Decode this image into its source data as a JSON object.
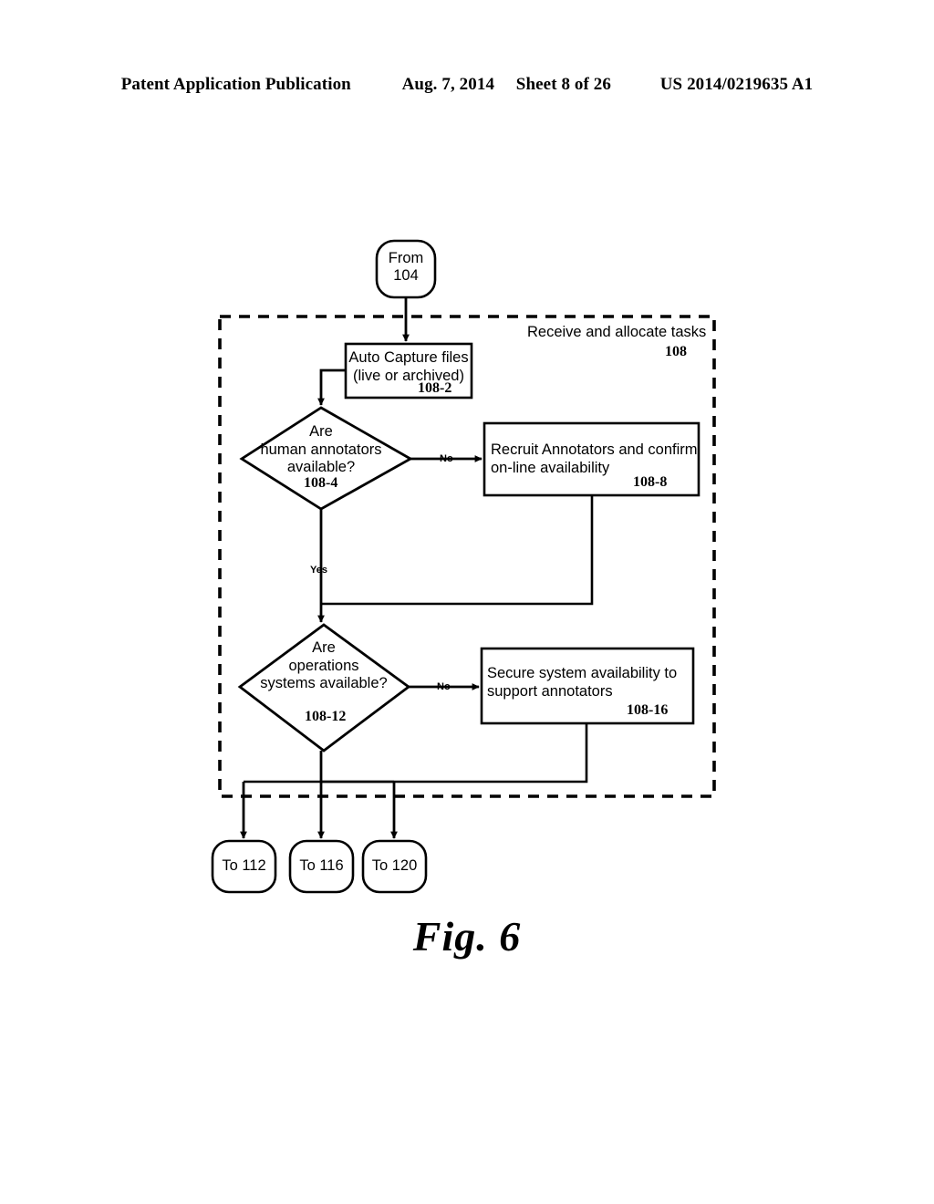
{
  "header": {
    "publication": "Patent Application Publication",
    "date": "Aug. 7, 2014",
    "sheet": "Sheet 8 of 26",
    "patent_number": "US 2014/0219635 A1"
  },
  "figure": {
    "caption": "Fig. 6",
    "group": {
      "label": "Receive and allocate tasks",
      "ref": "108"
    },
    "nodes": {
      "from_104": {
        "text": "From\n104"
      },
      "auto_capture": {
        "text": "Auto Capture files\n(live or archived)",
        "ref": "108-2"
      },
      "decision_annotators": {
        "text": "Are\nhuman annotators\navailable?",
        "ref": "108-4"
      },
      "recruit_annotators": {
        "text": "Recruit Annotators and confirm\non-line availability",
        "ref": "108-8"
      },
      "decision_ops_systems": {
        "text": "Are\noperations\nsystems available?",
        "ref": "108-12"
      },
      "secure_system": {
        "text": "Secure system availability to\nsupport annotators",
        "ref": "108-16"
      },
      "to_112": {
        "text": "To 112"
      },
      "to_116": {
        "text": "To 116"
      },
      "to_120": {
        "text": "To 120"
      }
    },
    "edge_labels": {
      "annotators_no": "No",
      "annotators_yes": "Yes",
      "ops_no": "No"
    }
  },
  "colors": {
    "ink": "#000000",
    "paper": "#ffffff"
  }
}
